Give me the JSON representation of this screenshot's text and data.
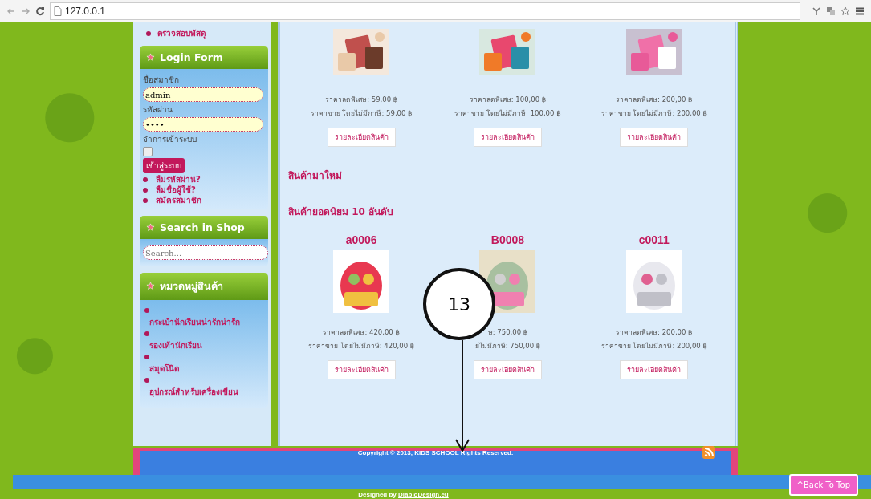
{
  "browser": {
    "url": "127.0.0.1"
  },
  "sidebar": {
    "top_link": "ตรวจสอบพัสดุ",
    "login": {
      "title": "Login Form",
      "username_label": "ชื่อสมาชิก",
      "username": "admin",
      "password_label": "รหัสผ่าน",
      "password": "••••",
      "remember_label": "จำการเข้าระบบ",
      "remember_checked": false,
      "submit": "เข้าสู่ระบบ",
      "links": [
        "ลืมรหัสผ่าน?",
        "ลืมชื่อผู้ใช้?",
        "สมัครสมาชิก"
      ]
    },
    "search": {
      "title": "Search in Shop",
      "placeholder": "Search..."
    },
    "categories": {
      "title": "หมวดหมู่สินค้า",
      "items": [
        "กระเป๋านักเรียนน่ารักน่ารัก",
        "รองเท้านักเรียน",
        "สมุดโน๊ต",
        "อุปกรณ์สำหรับเครื่องเขียน"
      ]
    }
  },
  "top_products": [
    {
      "special_price": "ราคาลดพิเศษ: 59,00 ฿",
      "price": "ราคาขาย โดยไม่มีภาษี: 59,00 ฿",
      "button": "รายละเอียดสินค้า"
    },
    {
      "special_price": "ราคาลดพิเศษ: 100,00 ฿",
      "price": "ราคาขาย โดยไม่มีภาษี: 100,00 ฿",
      "button": "รายละเอียดสินค้า"
    },
    {
      "special_price": "ราคาลดพิเศษ: 200,00 ฿",
      "price": "ราคาขาย โดยไม่มีภาษี: 200,00 ฿",
      "button": "รายละเอียดสินค้า"
    }
  ],
  "headings": [
    "สินค้ามาใหม่",
    "สินค้ายอดนิยม 10 อันดับ"
  ],
  "popular_products": [
    {
      "code": "a0006",
      "special_price": "ราคาลดพิเศษ: 420,00 ฿",
      "price": "ราคาขาย โดยไม่มีภาษี: 420,00 ฿",
      "button": "รายละเอียดสินค้า"
    },
    {
      "code": "B0008",
      "special_price": "ษ: 750,00 ฿",
      "price": "ยไม่มีภาษี: 750,00 ฿",
      "button": "รายละเอียดสินค้า"
    },
    {
      "code": "c0011",
      "special_price": "ราคาลดพิเศษ: 200,00 ฿",
      "price": "ราคาขาย โดยไม่มีภาษี: 200,00 ฿",
      "button": "รายละเอียดสินค้า"
    }
  ],
  "footer": {
    "copyright": "Copyright © 2013, KIDS SCHOOL Rights Reserved.",
    "designed_by": "Designed by",
    "designer_link": "DiabloDesign.eu",
    "back_to_top": "^Back To Top"
  },
  "callout": {
    "number": "13"
  }
}
